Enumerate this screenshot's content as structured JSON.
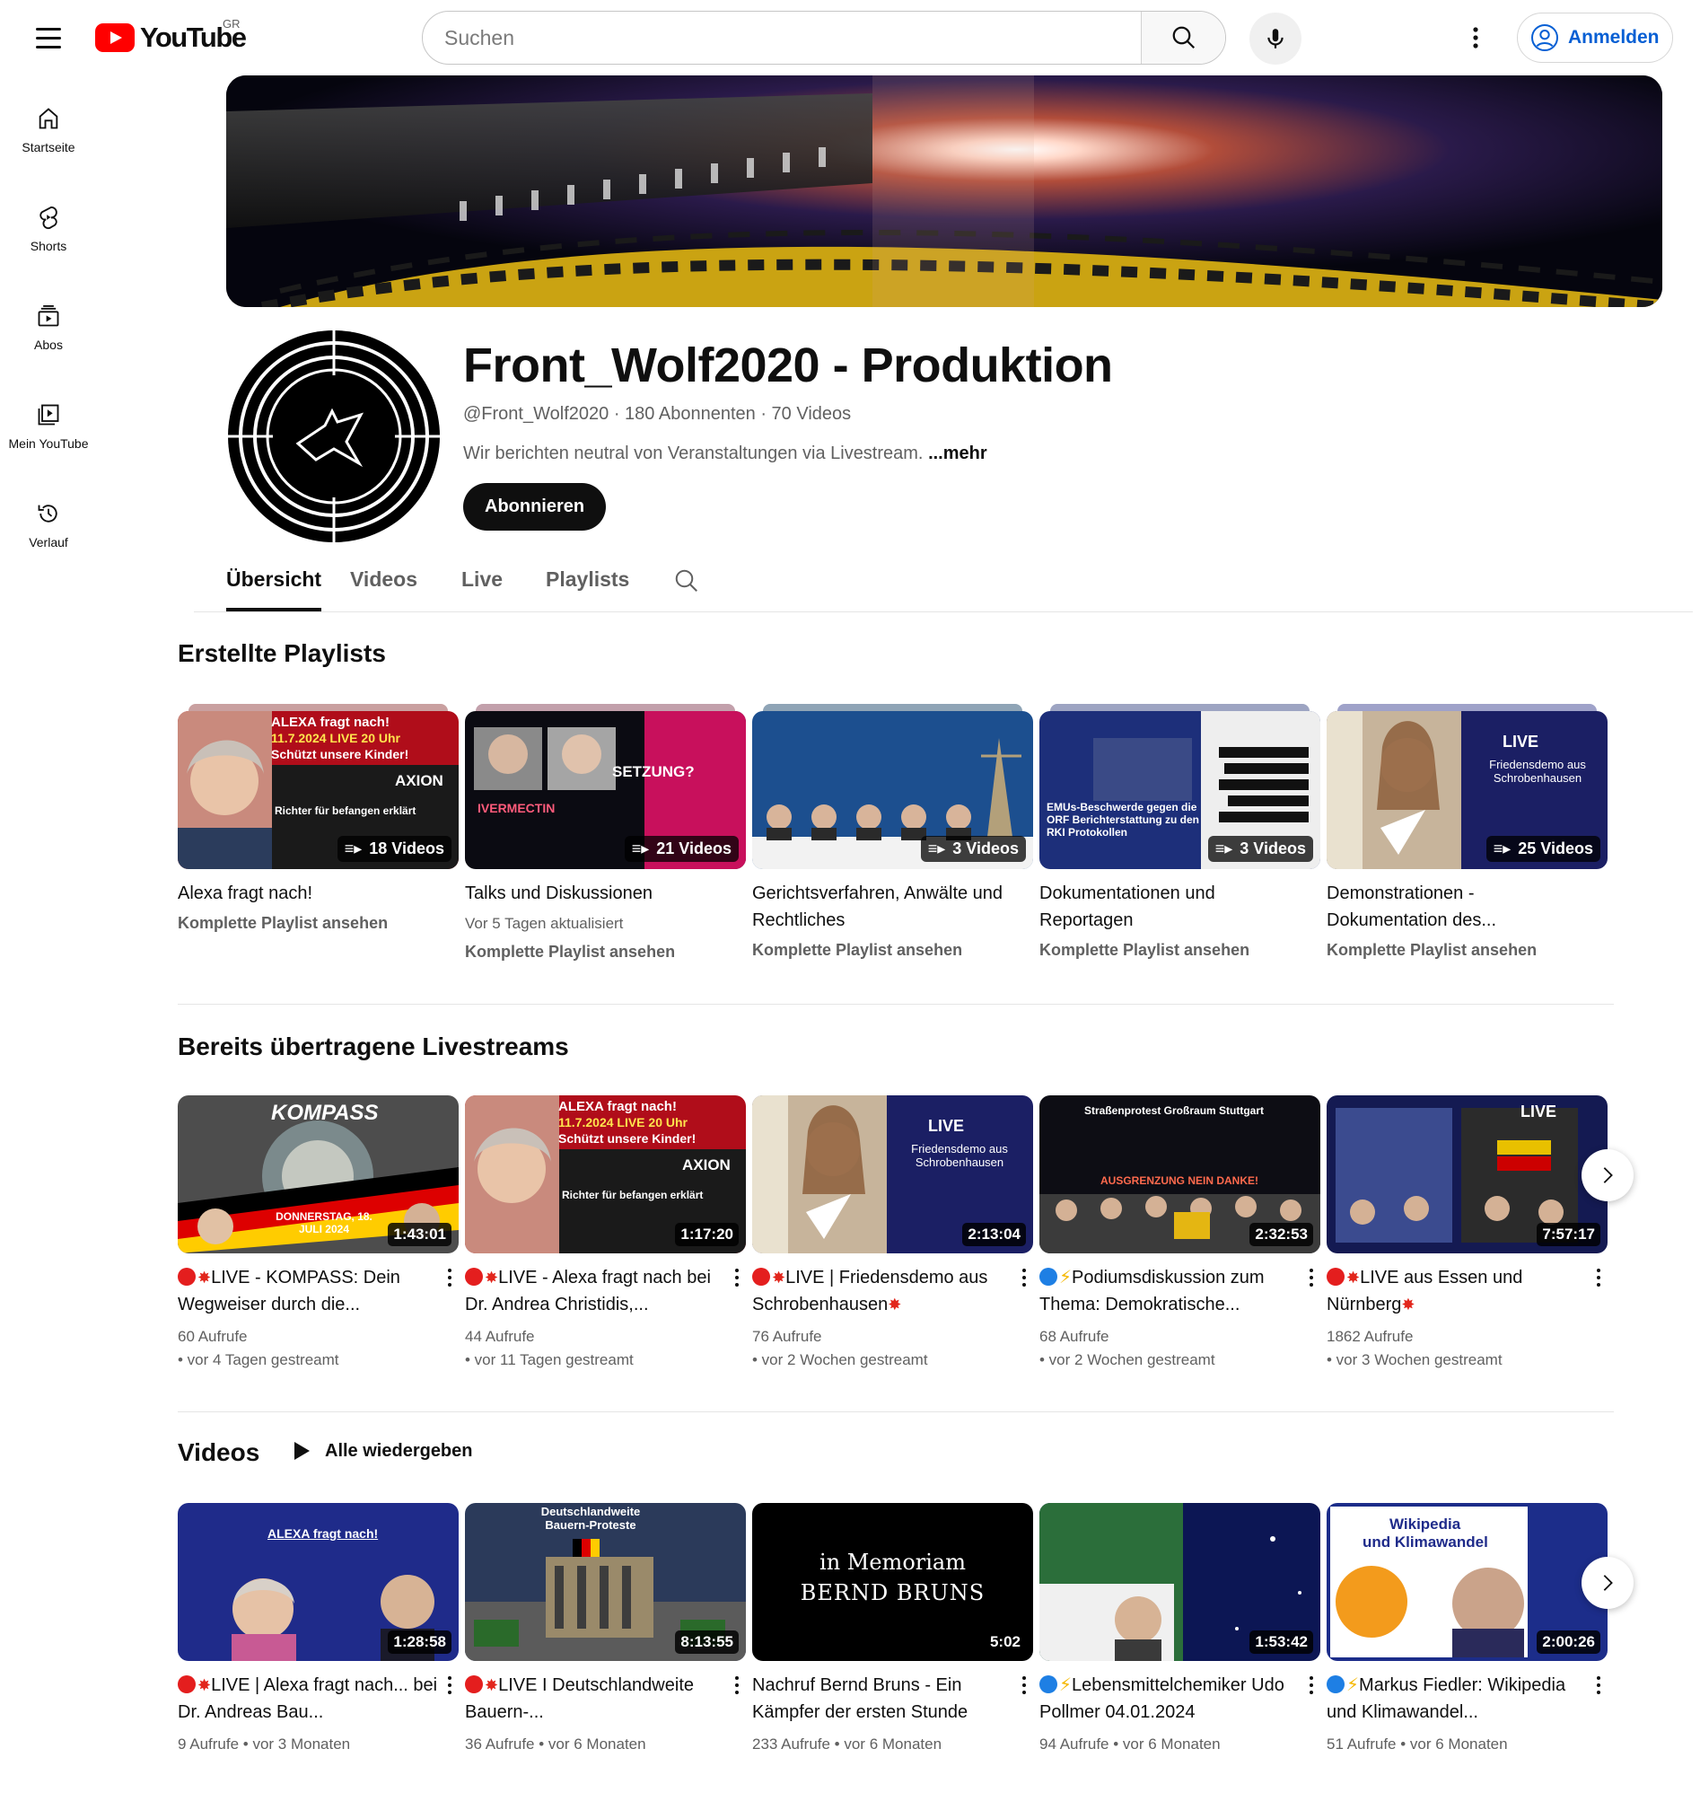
{
  "header": {
    "logo_text": "YouTube",
    "country_code": "GR",
    "search_placeholder": "Suchen",
    "signin_label": "Anmelden"
  },
  "sidebar": {
    "items": [
      {
        "label": "Startseite",
        "icon": "home-icon"
      },
      {
        "label": "Shorts",
        "icon": "shorts-icon"
      },
      {
        "label": "Abos",
        "icon": "subscriptions-icon"
      },
      {
        "label": "Mein YouTube",
        "icon": "library-icon"
      },
      {
        "label": "Verlauf",
        "icon": "history-icon"
      }
    ]
  },
  "channel": {
    "title": "Front_Wolf2020 - Produktion",
    "handle": "@Front_Wolf2020",
    "subscribers": "180 Abonnenten",
    "video_count": "70 Videos",
    "separator": "·",
    "description": "Wir berichten neutral von Veranstaltungen via Livestream.",
    "more_label": "...mehr",
    "subscribe_label": "Abonnieren"
  },
  "tabs": [
    {
      "label": "Übersicht",
      "active": true
    },
    {
      "label": "Videos",
      "active": false
    },
    {
      "label": "Live",
      "active": false
    },
    {
      "label": "Playlists",
      "active": false
    }
  ],
  "playlists_section": {
    "title": "Erstellte Playlists",
    "items": [
      {
        "title": "Alexa fragt nach!",
        "updated": "",
        "count": "18 Videos",
        "link": "Komplette Playlist ansehen"
      },
      {
        "title": "Talks und Diskussionen",
        "updated": "Vor 5 Tagen aktualisiert",
        "count": "21 Videos",
        "link": "Komplette Playlist ansehen"
      },
      {
        "title": "Gerichtsverfahren, Anwälte und Rechtliches",
        "updated": "",
        "count": "3 Videos",
        "link": "Komplette Playlist ansehen"
      },
      {
        "title": "Dokumentationen und Reportagen",
        "updated": "",
        "count": "3 Videos",
        "link": "Komplette Playlist ansehen"
      },
      {
        "title": "Demonstrationen - Dokumentation des...",
        "updated": "",
        "count": "25 Videos",
        "link": "Komplette Playlist ansehen"
      }
    ]
  },
  "livestreams_section": {
    "title": "Bereits übertragene Livestreams",
    "items": [
      {
        "title": "LIVE - KOMPASS: Dein Wegweiser durch die...",
        "views": "60 Aufrufe",
        "time": "• vor 4 Tagen gestreamt",
        "duration": "1:43:01"
      },
      {
        "title": "LIVE - Alexa fragt nach bei Dr. Andrea Christidis,...",
        "views": "44 Aufrufe",
        "time": "• vor 11 Tagen gestreamt",
        "duration": "1:17:20"
      },
      {
        "title": "LIVE | Friedensdemo aus Schrobenhausen",
        "views": "76 Aufrufe",
        "time": "• vor 2 Wochen gestreamt",
        "duration": "2:13:04"
      },
      {
        "title": "Podiumsdiskussion zum Thema: Demokratische...",
        "views": "68 Aufrufe",
        "time": "• vor 2 Wochen gestreamt",
        "duration": "2:32:53"
      },
      {
        "title": "LIVE aus Essen und Nürnberg",
        "views": "1862 Aufrufe",
        "time": "• vor 3 Wochen gestreamt",
        "duration": "7:57:17"
      }
    ]
  },
  "videos_section": {
    "title": "Videos",
    "play_all_label": "Alle wiedergeben",
    "items": [
      {
        "title": "LIVE | Alexa fragt nach... bei Dr. Andreas Bau...",
        "meta": "9 Aufrufe • vor 3 Monaten",
        "duration": "1:28:58"
      },
      {
        "title": "LIVE I Deutschlandweite Bauern-...",
        "meta": "36 Aufrufe • vor 6 Monaten",
        "duration": "8:13:55"
      },
      {
        "title": "Nachruf Bernd Bruns - Ein Kämpfer der ersten Stunde",
        "meta": "233 Aufrufe • vor 6 Monaten",
        "duration": "5:02"
      },
      {
        "title": "Lebensmittelchemiker Udo Pollmer 04.01.2024",
        "meta": "94 Aufrufe • vor 6 Monaten",
        "duration": "1:53:42"
      },
      {
        "title": "Markus Fiedler: Wikipedia und Klimawandel...",
        "meta": "51 Aufrufe • vor 6 Monaten",
        "duration": "2:00:26"
      }
    ]
  },
  "thumb_text": {
    "alexa_header1": "ALEXA fragt nach!",
    "alexa_header2": "11.7.2024 LIVE 20 Uhr",
    "alexa_header3": "Schützt unsere Kinder!",
    "alexa_sub": "Richter für befangen erklärt",
    "axion": "AXION",
    "talk_title": "SETZUNG?",
    "talk_topic": "IVERMECTIN",
    "demo_live": "LIVE",
    "demo_city": "Friedensdemo aus Schrobenhausen",
    "kompass": "KOMPASS",
    "kompass_date": "DONNERSTAG, 18. JULI 2024",
    "stuttgart_title": "Straßenprotest Großraum Stuttgart",
    "stuttgart_sub": "AUSGRENZUNG NEIN DANKE!",
    "memoriam1": "in Memoriam",
    "memoriam2": "BERND BRUNS",
    "wiki1": "Wikipedia",
    "wiki2": "und Klimawandel",
    "bauern": "Deutschlandweite Bauern-Proteste",
    "emus": "EMUs-Beschwerde gegen die ORF Berichterstattung zu den RKI Protokollen"
  },
  "colors": {
    "brand_red": "#ff0000",
    "link_blue": "#065fd4",
    "text_primary": "#0f0f0f",
    "text_secondary": "#606060"
  }
}
